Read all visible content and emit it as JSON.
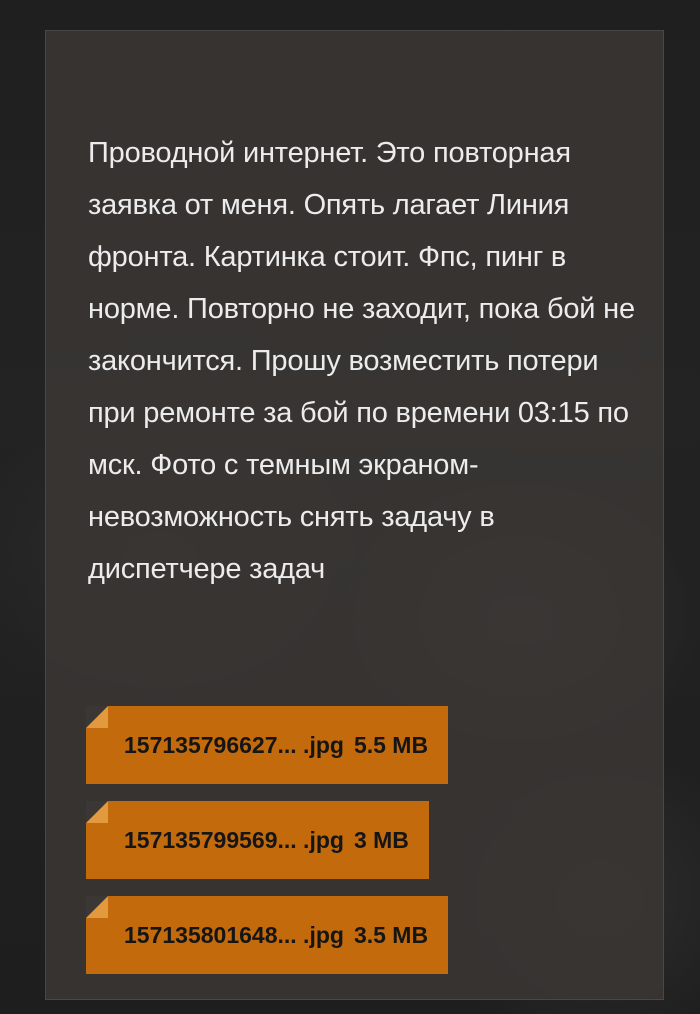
{
  "message": {
    "text": "Проводной интернет. Это повторная заявка от меня. Опять лагает Линия фронта. Картинка стоит. Фпс, пинг в норме. Повторно не заходит, пока бой не закончится. Прошу возместить потери при ремонте за бой по времени 03:15 по мск. Фото с темным экраном- невозможность снять задачу в диспетчере задач"
  },
  "attachments": [
    {
      "name": "157135796627... .jpg",
      "size": "5.5 MB",
      "icon": "file-fold-icon"
    },
    {
      "name": "157135799569... .jpg",
      "size": "3 MB",
      "icon": "file-fold-icon"
    },
    {
      "name": "157135801648... .jpg",
      "size": "3.5 MB",
      "icon": "file-fold-icon"
    }
  ],
  "colors": {
    "accent": "#c26a0c",
    "panel": "#3a3734",
    "text": "#ececec"
  }
}
